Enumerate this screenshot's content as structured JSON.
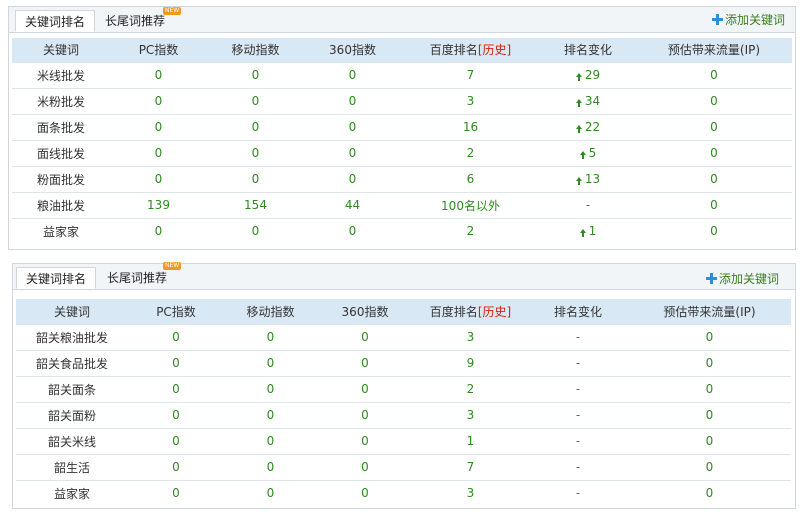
{
  "panel1": {
    "tabs": [
      {
        "label": "关键词排名",
        "active": true
      },
      {
        "label": "长尾词推荐",
        "active": false,
        "badge": "NEW"
      }
    ],
    "add_keyword": "添加关键词",
    "headers": [
      "关键词",
      "PC指数",
      "移动指数",
      "360指数",
      "百度排名",
      "历史",
      "排名变化",
      "预估带来流量(IP)"
    ],
    "rows": [
      {
        "keyword": "米线批发",
        "pc": "0",
        "mobile": "0",
        "s360": "0",
        "baidu": "7",
        "change": "29",
        "direction": "up",
        "traffic": "0"
      },
      {
        "keyword": "米粉批发",
        "pc": "0",
        "mobile": "0",
        "s360": "0",
        "baidu": "3",
        "change": "34",
        "direction": "up",
        "traffic": "0"
      },
      {
        "keyword": "面条批发",
        "pc": "0",
        "mobile": "0",
        "s360": "0",
        "baidu": "16",
        "change": "22",
        "direction": "up",
        "traffic": "0"
      },
      {
        "keyword": "面线批发",
        "pc": "0",
        "mobile": "0",
        "s360": "0",
        "baidu": "2",
        "change": "5",
        "direction": "up",
        "traffic": "0"
      },
      {
        "keyword": "粉面批发",
        "pc": "0",
        "mobile": "0",
        "s360": "0",
        "baidu": "6",
        "change": "13",
        "direction": "up",
        "traffic": "0"
      },
      {
        "keyword": "粮油批发",
        "pc": "139",
        "mobile": "154",
        "s360": "44",
        "baidu": "100名以外",
        "change": "-",
        "direction": "none",
        "traffic": "0"
      },
      {
        "keyword": "益家家",
        "pc": "0",
        "mobile": "0",
        "s360": "0",
        "baidu": "2",
        "change": "1",
        "direction": "up",
        "traffic": "0"
      }
    ]
  },
  "panel2": {
    "tabs": [
      {
        "label": "关键词排名",
        "active": true
      },
      {
        "label": "长尾词推荐",
        "active": false,
        "badge": "NEW"
      }
    ],
    "add_keyword": "添加关键词",
    "headers": [
      "关键词",
      "PC指数",
      "移动指数",
      "360指数",
      "百度排名",
      "历史",
      "排名变化",
      "预估带来流量(IP)"
    ],
    "rows": [
      {
        "keyword": "韶关粮油批发",
        "pc": "0",
        "mobile": "0",
        "s360": "0",
        "baidu": "3",
        "change": "-",
        "direction": "none",
        "traffic": "0"
      },
      {
        "keyword": "韶关食品批发",
        "pc": "0",
        "mobile": "0",
        "s360": "0",
        "baidu": "9",
        "change": "-",
        "direction": "none",
        "traffic": "0"
      },
      {
        "keyword": "韶关面条",
        "pc": "0",
        "mobile": "0",
        "s360": "0",
        "baidu": "2",
        "change": "-",
        "direction": "none",
        "traffic": "0"
      },
      {
        "keyword": "韶关面粉",
        "pc": "0",
        "mobile": "0",
        "s360": "0",
        "baidu": "3",
        "change": "-",
        "direction": "none",
        "traffic": "0"
      },
      {
        "keyword": "韶关米线",
        "pc": "0",
        "mobile": "0",
        "s360": "0",
        "baidu": "1",
        "change": "-",
        "direction": "none",
        "traffic": "0"
      },
      {
        "keyword": "韶生活",
        "pc": "0",
        "mobile": "0",
        "s360": "0",
        "baidu": "7",
        "change": "-",
        "direction": "none",
        "traffic": "0"
      },
      {
        "keyword": "益家家",
        "pc": "0",
        "mobile": "0",
        "s360": "0",
        "baidu": "3",
        "change": "-",
        "direction": "none",
        "traffic": "0"
      }
    ]
  },
  "colors": {
    "accent_green": "#2e8b1f",
    "history_red": "#d81e06",
    "header_blue": "#d9e8f5",
    "badge_orange": "#f39a1e",
    "plus_blue": "#2a8fd8"
  }
}
